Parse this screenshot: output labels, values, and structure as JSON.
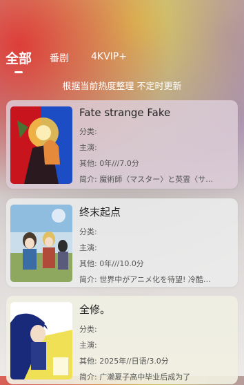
{
  "tabs": [
    {
      "label": "全部"
    },
    {
      "label": "番剧"
    },
    {
      "label": "4KVIP+"
    }
  ],
  "subtitle": "根据当前热度整理 不定时更新",
  "items": [
    {
      "title": "Fate strange Fake",
      "category_label": "分类:",
      "cast_label": "主演:",
      "other": "其他: 0年///7.0分",
      "intro": "简介: 魔術師〈マスター〉と英霊〈サ…",
      "poster_text": "Fate strange Fake"
    },
    {
      "title": "终末起点",
      "category_label": "分类:",
      "cast_label": "主演:",
      "other": "其他: 0年///10.0分",
      "intro": "简介: 世界中がアニメ化を待望! 冷酷…"
    },
    {
      "title": "全修。",
      "category_label": "分类:",
      "cast_label": "主演:",
      "other": "其他: 2025年//日语/3.0分",
      "intro": "简介: 广濑夏子高中毕业后成为了"
    }
  ],
  "colors": {
    "poster1": [
      "#c8141d",
      "#1d4dc4"
    ],
    "poster2": [
      "#3a6ca6",
      "#8fa85f"
    ],
    "poster3": [
      "#1a2a7b",
      "#f0e055"
    ]
  }
}
